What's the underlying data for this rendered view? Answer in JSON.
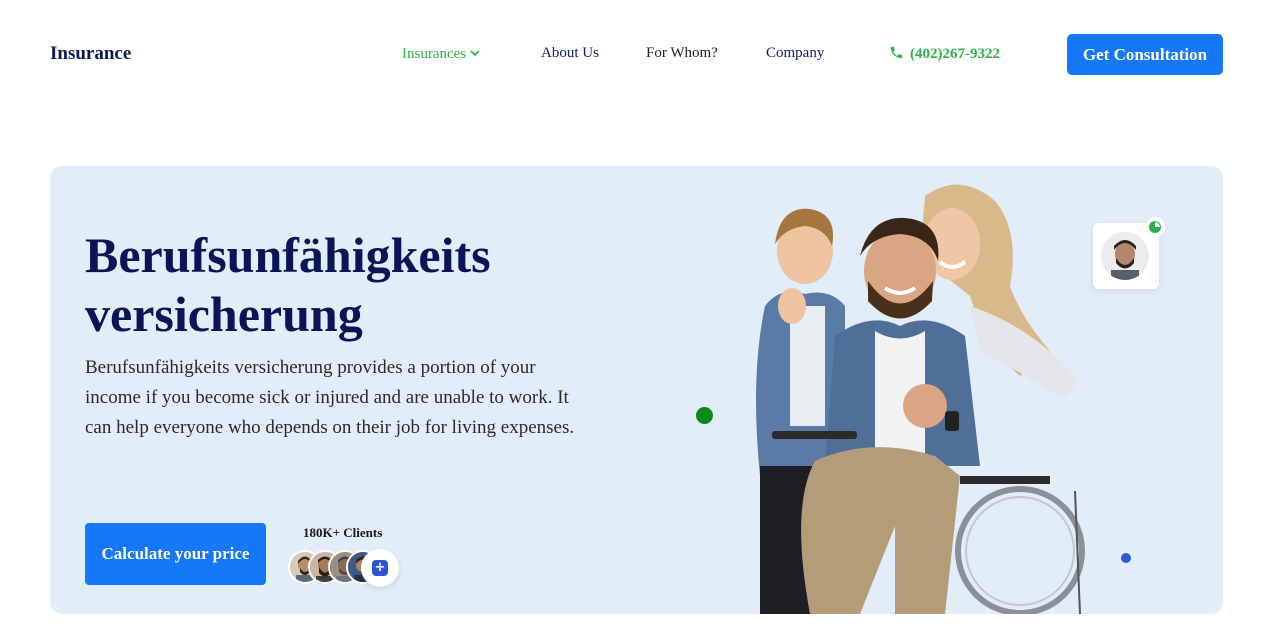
{
  "header": {
    "logo": "Insurance",
    "nav": {
      "insurances": "Insurances",
      "about": "About Us",
      "for_whom": "For Whom?",
      "company": "Company"
    },
    "phone": "(402)267-9322",
    "cta": "Get Consultation"
  },
  "hero": {
    "title": "Berufsunfähigkeits versicherung",
    "description": "Berufsunfähigkeits versicherung provides a portion of your income if you become sick or injured and are unable to work. It can help everyone who depends on their job for living expenses.",
    "calc_button": "Calculate your price",
    "clients_label": "180K+ Clients"
  },
  "colors": {
    "accent_blue": "#1677f8",
    "accent_green": "#2db14a",
    "hero_bg": "#e1edf8",
    "heading": "#0b1457"
  }
}
